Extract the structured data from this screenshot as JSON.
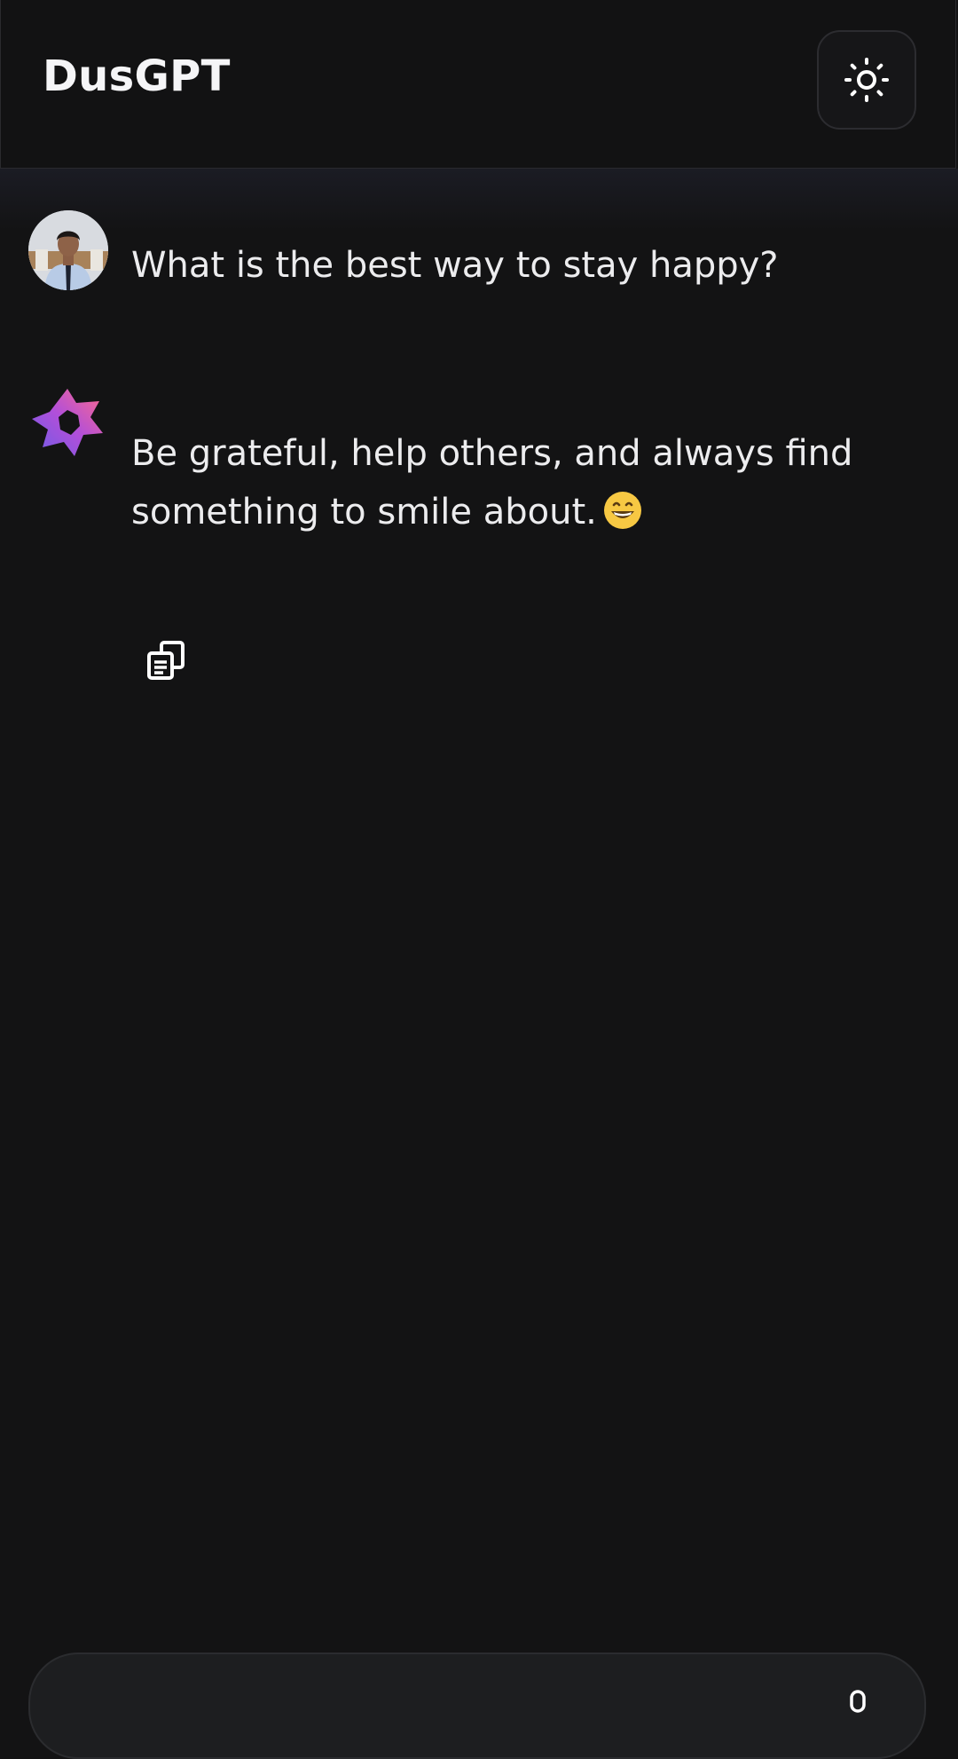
{
  "header": {
    "title": "DusGPT",
    "theme_toggle_icon": "sun-icon"
  },
  "chat": {
    "messages": [
      {
        "role": "user",
        "avatar_icon": "user-avatar",
        "text": "What is the best way to stay happy?"
      },
      {
        "role": "assistant",
        "avatar_icon": "dusgpt-logo",
        "text": "Be grateful, help others, and always find something to smile about.",
        "emoji_icon": "grinning-face-emoji",
        "actions": [
          {
            "icon": "copy-icon"
          }
        ]
      }
    ]
  },
  "composer": {
    "placeholder": "",
    "mic_icon": "mic-icon"
  },
  "colors": {
    "background": "#131314",
    "header_background": "#121213",
    "text": "#ececee",
    "logo_gradient_start": "#6c5ce7",
    "logo_gradient_end": "#ff6b8b"
  }
}
